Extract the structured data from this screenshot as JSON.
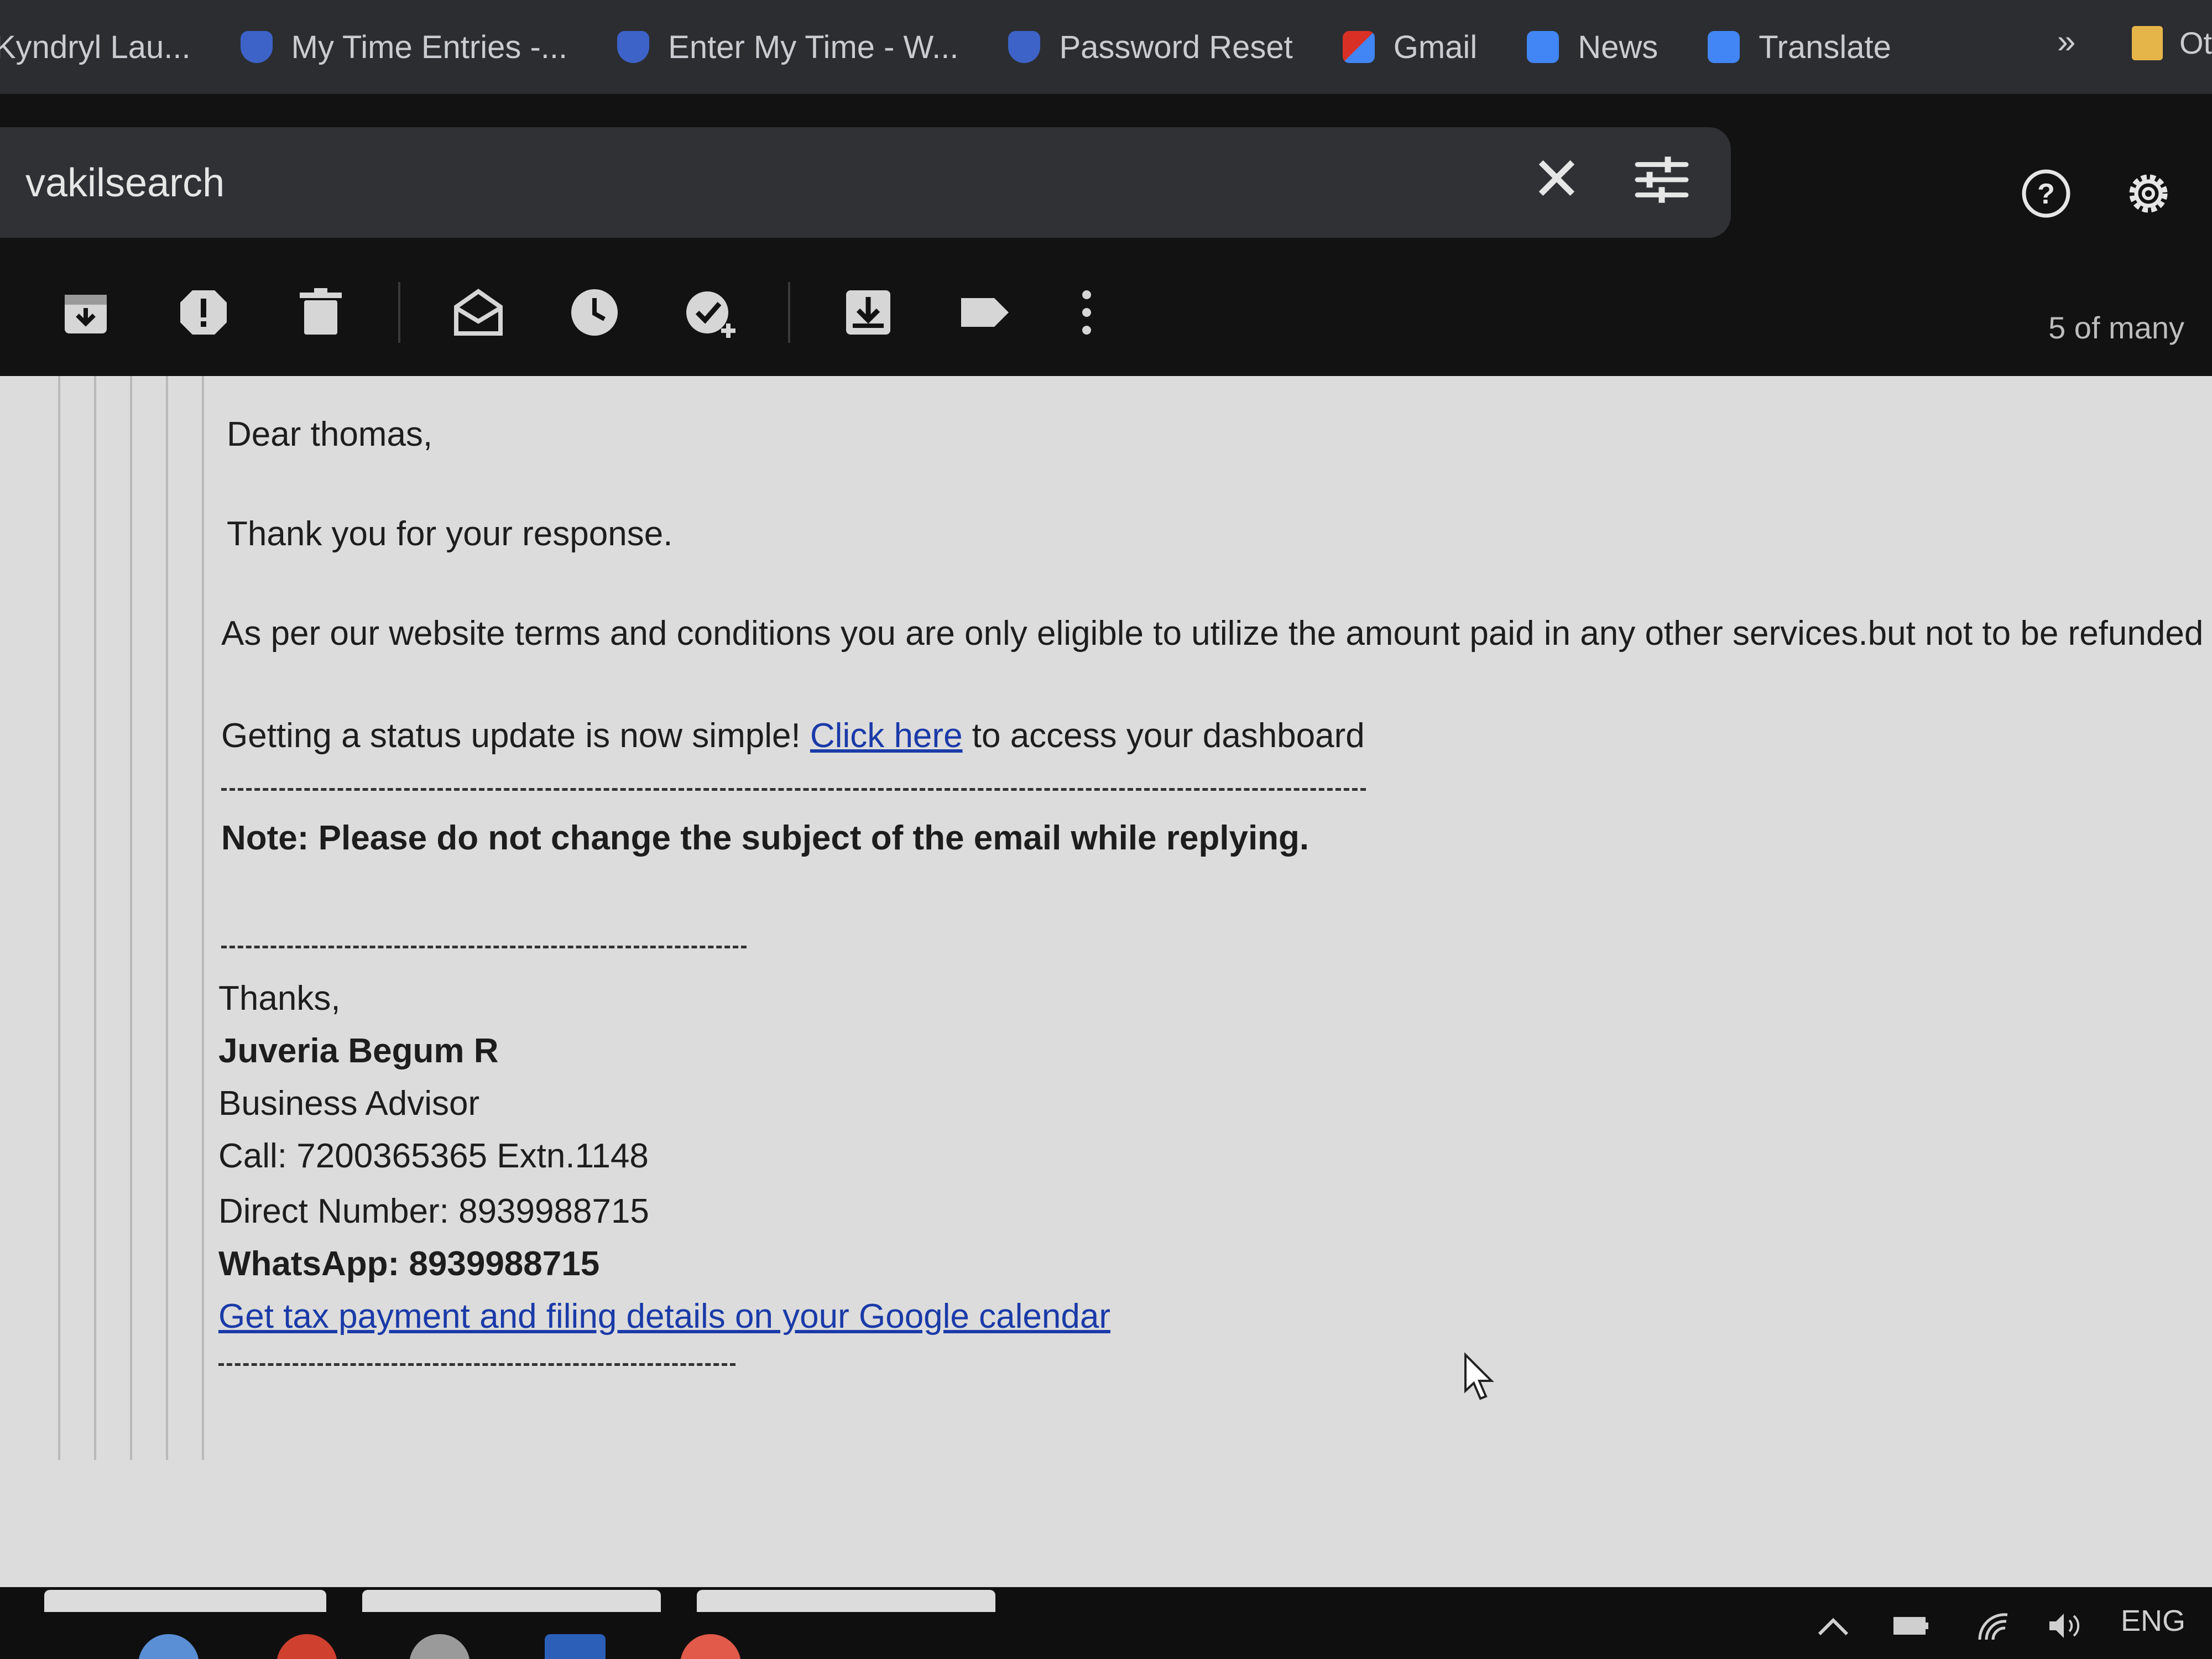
{
  "bookmarks": {
    "items": [
      {
        "label": "Kyndryl Lau...",
        "icon": "kyndryl-icon",
        "color": "#2b2d31"
      },
      {
        "label": "My Time Entries -...",
        "icon": "shield-icon",
        "color": "#3d63c8"
      },
      {
        "label": "Enter My Time - W...",
        "icon": "shield-icon",
        "color": "#3d63c8"
      },
      {
        "label": "Password Reset",
        "icon": "shield-icon",
        "color": "#3d63c8"
      },
      {
        "label": "Gmail",
        "icon": "gmail-icon",
        "color": "#d93025"
      },
      {
        "label": "News",
        "icon": "news-icon",
        "color": "#4285f4"
      },
      {
        "label": "Translate",
        "icon": "translate-icon",
        "color": "#4285f4"
      }
    ],
    "more": "»",
    "other_folder": "Ot"
  },
  "search": {
    "query": "vakilsearch",
    "close_icon": "close-icon",
    "options_icon": "search-options-icon"
  },
  "header_icons": [
    "help-icon",
    "settings-icon"
  ],
  "toolbar": {
    "icons": [
      "archive-icon",
      "report-spam-icon",
      "delete-icon",
      "mark-unread-icon",
      "snooze-icon",
      "add-to-tasks-icon",
      "move-to-icon",
      "label-icon",
      "more-icon"
    ],
    "counter": "5 of many"
  },
  "email": {
    "greeting": "Dear thomas,",
    "thanks_line": "Thank you for your response.",
    "terms_line": "As per our website terms and conditions you are only eligible to utilize the amount paid in any other services.but not to be refunded",
    "status_prefix": "Getting a status update is now simple! ",
    "status_link": "Click here",
    "status_suffix": " to access your dashboard",
    "note": "Note: Please do not change the subject of the email while replying.",
    "signoff": "Thanks,",
    "signature_name": "Juveria Begum R",
    "signature_title": "Business Advisor",
    "call": "Call: 7200365365 Extn.1148",
    "direct": "Direct Number: 8939988715",
    "whatsapp": "WhatsApp: 8939988715",
    "calendar_link": "Get tax payment and filing details on your Google calendar"
  },
  "taskbar": {
    "tray": {
      "language": "ENG",
      "icons": [
        "chevron-up-icon",
        "battery-icon",
        "wifi-icon",
        "volume-icon"
      ]
    }
  },
  "colors": {
    "link": "#1a3aa8",
    "background_dark": "#121212",
    "email_background": "#dcdcdc"
  }
}
